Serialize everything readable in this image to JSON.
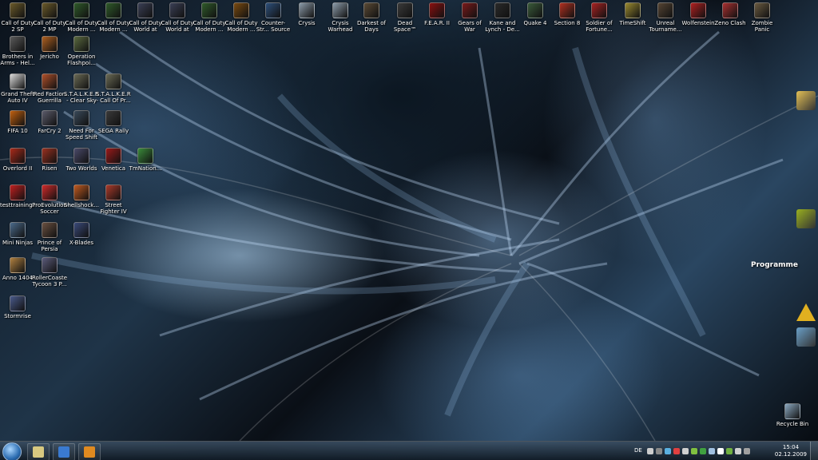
{
  "desktop_icons": [
    {
      "label": "Call of Duty 2 SP",
      "color": "#6b5a2a"
    },
    {
      "label": "Call of Duty 2 MP",
      "color": "#6b5a2a"
    },
    {
      "label": "Call of Duty Modern ...",
      "color": "#2f5a2a"
    },
    {
      "label": "Call of Duty Modern ...",
      "color": "#2f5a2a"
    },
    {
      "label": "Call of Duty World at W...",
      "color": "#3a3f55"
    },
    {
      "label": "Call of Duty World at W...",
      "color": "#3a3f55"
    },
    {
      "label": "Call of Duty Modern ...",
      "color": "#2f5a2a"
    },
    {
      "label": "Call of Duty Modern ...",
      "color": "#7a4a10"
    },
    {
      "label": "Counter-Str... Source Non...",
      "color": "#2d4f7a"
    },
    {
      "label": "Crysis",
      "color": "#8a9aa8"
    },
    {
      "label": "Crysis Warhead",
      "color": "#8a9aa8"
    },
    {
      "label": "Darkest of Days",
      "color": "#5a4a35"
    },
    {
      "label": "Dead Space™",
      "color": "#3a3a3a"
    },
    {
      "label": "F.E.A.R. II",
      "color": "#8a1010"
    },
    {
      "label": "Gears of War",
      "color": "#7a1a1a"
    },
    {
      "label": "Kane and Lynch - De...",
      "color": "#2a2a2a"
    },
    {
      "label": "Quake 4",
      "color": "#3a5a3a"
    },
    {
      "label": "Section 8",
      "color": "#b03020"
    },
    {
      "label": "Soldier of Fortune...",
      "color": "#aa2222"
    },
    {
      "label": "TimeShift",
      "color": "#9a8a30"
    },
    {
      "label": "Unreal Tourname...",
      "color": "#554433"
    },
    {
      "label": "Wolfenstein",
      "color": "#b02020"
    },
    {
      "label": "Zeno Clash",
      "color": "#aa3030"
    },
    {
      "label": "Zombie Panic Source",
      "color": "#6a5a40"
    },
    {
      "label": "Brothers in Arms - Hel...",
      "color": "#5a5a5a"
    },
    {
      "label": "Jericho",
      "color": "#b06020"
    },
    {
      "label": "Operation Flashpoi...",
      "color": "#5a6a40"
    },
    {
      "label": "Grand Theft Auto IV",
      "color": "#d8d8d8"
    },
    {
      "label": "Red Faction Guerrilla",
      "color": "#b0502a"
    },
    {
      "label": "S.T.A.L.K.E.R. - Clear Sky",
      "color": "#6a6a55"
    },
    {
      "label": "S.T.A.L.K.E.R. - Call Of Pr...",
      "color": "#6a6a55"
    },
    {
      "label": "FIFA 10",
      "color": "#c06010"
    },
    {
      "label": "FarCry 2",
      "color": "#5a5a6a"
    },
    {
      "label": "Need For Speed Shift",
      "color": "#3a4a5a"
    },
    {
      "label": "SEGA Rally",
      "color": "#3a3a3a"
    },
    {
      "label": "Overlord II",
      "color": "#aa2a1a"
    },
    {
      "label": "Risen",
      "color": "#9a3020"
    },
    {
      "label": "Two Worlds",
      "color": "#4a4a6a"
    },
    {
      "label": "Venetica",
      "color": "#9a1a1a"
    },
    {
      "label": "TmNation...",
      "color": "#3a8a3a"
    },
    {
      "label": "testtraining...",
      "color": "#c02020"
    },
    {
      "label": "ProEvolution Soccer",
      "color": "#d02a2a"
    },
    {
      "label": "Shellshock...",
      "color": "#c05a20"
    },
    {
      "label": "Street Fighter IV",
      "color": "#aa3a2a"
    },
    {
      "label": "Mini Ninjas",
      "color": "#4a6a8a"
    },
    {
      "label": "Prince of Persia",
      "color": "#6a5040"
    },
    {
      "label": "X-Blades",
      "color": "#3a4a7a"
    },
    {
      "label": "Anno 1404",
      "color": "#b08040"
    },
    {
      "label": "RollerCoaster Tycoon 3 P...",
      "color": "#5a5a7a"
    },
    {
      "label": "Stormrise",
      "color": "#4a5a8a"
    },
    {
      "label": "Recycle Bin",
      "color": "#8aa8c0"
    }
  ],
  "right_side": {
    "programme_label": "Programme",
    "icons": [
      {
        "name": "folder",
        "color": "#e3c056"
      },
      {
        "name": "game-tile",
        "color": "#9ab020"
      },
      {
        "name": "warning",
        "color": "#e0b020"
      },
      {
        "name": "shortcut",
        "color": "#6aa0c8"
      }
    ]
  },
  "taskbar": {
    "pinned": [
      {
        "name": "library-folder",
        "color": "#d8c880"
      },
      {
        "name": "internet-explorer",
        "color": "#3a7ad0"
      },
      {
        "name": "media-player",
        "color": "#e08a20"
      }
    ],
    "language": "DE",
    "tray_colors": [
      "#cccccc",
      "#888888",
      "#5ab0e0",
      "#e04040",
      "#d0d0d0",
      "#80c040",
      "#40a040",
      "#a0c0e0",
      "#ffffff",
      "#70b040",
      "#d0d0d0",
      "#a0a0a0"
    ],
    "time": "15:04",
    "date": "02.12.2009"
  }
}
